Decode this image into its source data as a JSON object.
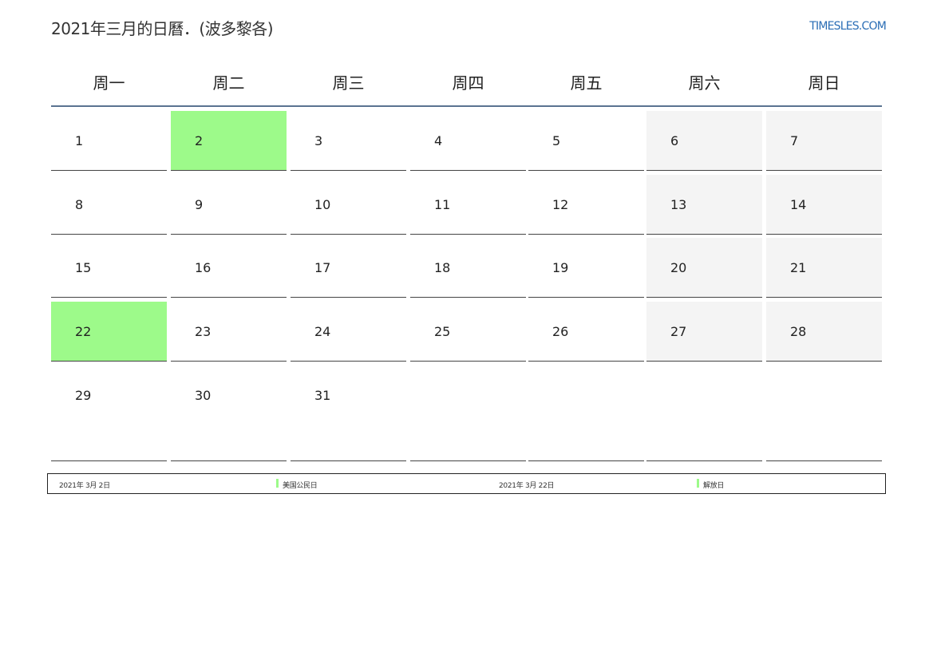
{
  "header": {
    "title": "2021年三月的日曆．(波多黎各)",
    "site": "TIMESLES.COM"
  },
  "weekdays": [
    "周一",
    "周二",
    "周三",
    "周四",
    "周五",
    "周六",
    "周日"
  ],
  "weeks": [
    [
      "1",
      "2",
      "3",
      "4",
      "5",
      "6",
      "7"
    ],
    [
      "8",
      "9",
      "10",
      "11",
      "12",
      "13",
      "14"
    ],
    [
      "15",
      "16",
      "17",
      "18",
      "19",
      "20",
      "21"
    ],
    [
      "22",
      "23",
      "24",
      "25",
      "26",
      "27",
      "28"
    ],
    [
      "29",
      "30",
      "31",
      "",
      "",
      "",
      ""
    ]
  ],
  "holiday_days": [
    "2",
    "22"
  ],
  "colors": {
    "holiday": "#9dfa8a",
    "weekend": "#f4f4f4",
    "header_rule": "#5a7390",
    "link": "#2a6db5"
  },
  "legend": [
    {
      "date": "2021年 3月 2日",
      "name": "美国公民日"
    },
    {
      "date": "2021年 3月 22日",
      "name": "解放日"
    }
  ]
}
